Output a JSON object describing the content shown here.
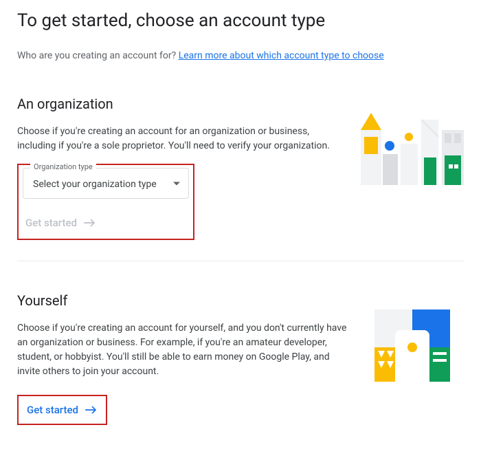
{
  "page": {
    "title": "To get started, choose an account type",
    "intro_prefix": "Who are you creating an account for? ",
    "learn_more": "Learn more about which account type to choose"
  },
  "organization": {
    "title": "An organization",
    "description": "Choose if you're creating an account for an organization or business, including if you're a sole proprietor. You'll need to verify your organization.",
    "select": {
      "label": "Organization type",
      "placeholder": "Select your organization type"
    },
    "button_label": "Get started"
  },
  "yourself": {
    "title": "Yourself",
    "description": "Choose if you're creating an account for yourself, and you don't currently have an organization or business. For example, if you're an amateur developer, student, or hobbyist. You'll still be able to earn money on Google Play, and invite others to join your account.",
    "button_label": "Get started"
  },
  "colors": {
    "primary": "#1a73e8",
    "highlight_border": "#c5221f",
    "disabled": "#bdc1c6"
  }
}
